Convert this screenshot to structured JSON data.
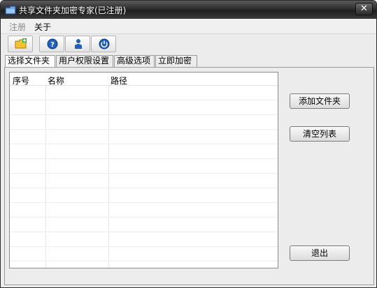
{
  "window": {
    "title": "共享文件夹加密专家(已注册)",
    "close_label": "✕"
  },
  "menu": {
    "register": "注册",
    "about": "关于"
  },
  "toolbar": {
    "buttons": [
      {
        "name": "add-folder",
        "icon": "folder-add-icon"
      },
      {
        "name": "help",
        "icon": "help-icon"
      },
      {
        "name": "user",
        "icon": "user-icon"
      },
      {
        "name": "power",
        "icon": "power-icon"
      }
    ]
  },
  "tabs": [
    {
      "label": "选择文件夹",
      "active": true
    },
    {
      "label": "用户权限设置",
      "active": false
    },
    {
      "label": "高级选项",
      "active": false
    },
    {
      "label": "立即加密",
      "active": false
    }
  ],
  "list": {
    "columns": [
      "序号",
      "名称",
      "路径"
    ],
    "rows": []
  },
  "buttons": {
    "add_folder": "添加文件夹",
    "clear_list": "清空列表",
    "exit": "退出"
  },
  "colors": {
    "titlebar": "#2e2e2e",
    "accent_blue": "#1f5fbf",
    "folder_yellow": "#f2c230"
  }
}
